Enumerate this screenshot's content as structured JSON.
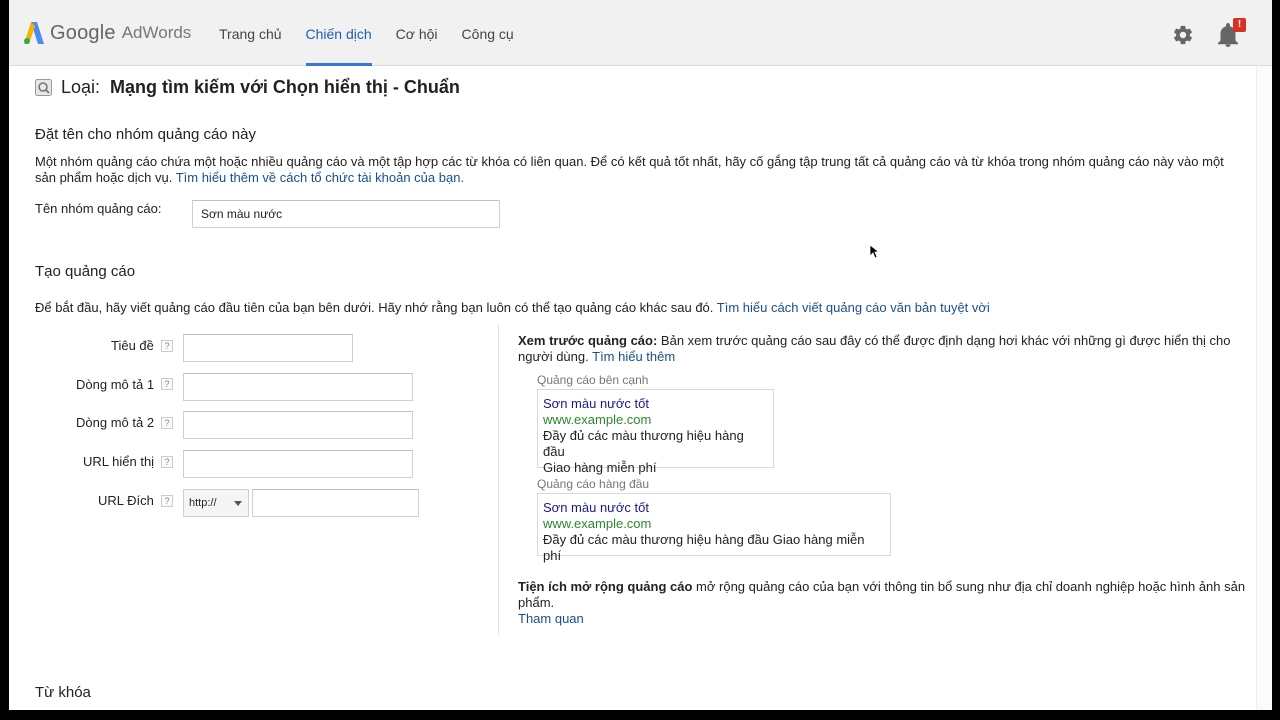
{
  "header": {
    "logo_google": "Google",
    "logo_adwords": "AdWords",
    "nav": [
      {
        "label": "Trang chủ",
        "active": false
      },
      {
        "label": "Chiến dịch",
        "active": true
      },
      {
        "label": "Cơ hội",
        "active": false
      },
      {
        "label": "Công cụ",
        "active": false
      }
    ],
    "notification_badge": "!",
    "icons": [
      "adwords-logo-icon",
      "gear-icon",
      "bell-icon"
    ]
  },
  "campaign_type": {
    "label": "Loại:",
    "value": "Mạng tìm kiếm với Chọn hiển thị - Chuẩn"
  },
  "ad_group": {
    "title": "Đặt tên cho nhóm quảng cáo này",
    "description": "Một nhóm quảng cáo chứa một hoặc nhiều quảng cáo và một tập hợp các từ khóa có liên quan. Để có kết quả tốt nhất, hãy cố gắng tập trung tất cả quảng cáo và từ khóa trong nhóm quảng cáo này vào một sản phẩm hoặc dịch vụ.",
    "link": "Tìm hiểu thêm về cách tổ chức tài khoản của bạn.",
    "name_label": "Tên nhóm quảng cáo:",
    "name_value": "Sơn màu nước"
  },
  "create_ad": {
    "title": "Tạo quảng cáo",
    "description": "Để bắt đầu, hãy viết quảng cáo đầu tiên của bạn bên dưới. Hãy nhớ rằng bạn luôn có thể tạo quảng cáo khác sau đó.",
    "link": "Tìm hiểu cách viết quảng cáo văn bản tuyệt vời",
    "fields": {
      "headline_label": "Tiêu đề",
      "desc1_label": "Dòng mô tả 1",
      "desc2_label": "Dòng mô tả 2",
      "display_url_label": "URL hiển thị",
      "dest_url_label": "URL Đích",
      "help_glyph": "?",
      "protocol_value": "http://"
    }
  },
  "preview": {
    "heading_bold": "Xem trước quảng cáo:",
    "heading_text": "Bản xem trước quảng cáo sau đây có thể được định dạng hơi khác với những gì được hiển thị cho người dùng.",
    "heading_link": "Tìm hiểu thêm",
    "side_label": "Quảng cáo bên cạnh",
    "side_ad": {
      "title": "Sơn màu nước tốt",
      "url": "www.example.com",
      "line1": "Đầy đủ các màu thương hiệu hàng đầu",
      "line2": "Giao hàng miễn phí"
    },
    "top_label": "Quảng cáo hàng đầu",
    "top_ad": {
      "title": "Sơn màu nước tốt",
      "url": "www.example.com",
      "line1": "Đầy đủ các màu thương hiệu hàng đầu Giao hàng miễn phí"
    }
  },
  "extensions": {
    "bold": "Tiện ích mở rộng quảng cáo",
    "text": "mở rộng quảng cáo của bạn với thông tin bổ sung như địa chỉ doanh nghiệp hoặc hình ảnh sản phẩm.",
    "link": "Tham quan"
  },
  "keywords": {
    "title": "Từ khóa"
  },
  "colors": {
    "link": "#1a4f8b",
    "nav_active": "#1a5fb4",
    "ad_url_green": "#2b8a2b",
    "badge_red": "#d93025"
  }
}
